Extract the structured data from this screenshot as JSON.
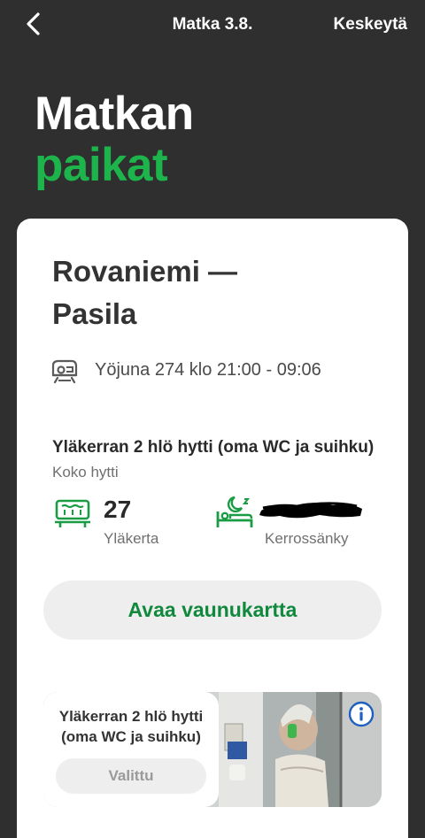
{
  "nav": {
    "title": "Matka 3.8.",
    "cancel_label": "Keskeytä",
    "back_icon": "chevron-left-icon"
  },
  "heading": {
    "line1": "Matkan",
    "line2": "paikat"
  },
  "colors": {
    "accent_green": "#1db44c",
    "button_green": "#10893d",
    "background": "#2f2f2f"
  },
  "trip": {
    "route_from": "Rovaniemi —",
    "route_to": "Pasila",
    "train_icon": "train-icon",
    "train_info": "Yöjuna 274 klo 21:00 - 09:06"
  },
  "cabin": {
    "type": "Yläkerran 2 hlö hytti (oma WC ja suihku)",
    "subtitle": "Koko hytti",
    "seat_icon": "cabin-seat-icon",
    "seat_number": "27",
    "seat_label": "Yläkerta",
    "bed_icon": "bed-moon-icon",
    "bed_label": "Kerrossänky"
  },
  "map_button_label": "Avaa vaunukartta",
  "option": {
    "title": "Yläkerran 2 hlö hytti (oma WC ja suihku)",
    "button_label": "Valittu",
    "info_icon": "info-icon"
  }
}
